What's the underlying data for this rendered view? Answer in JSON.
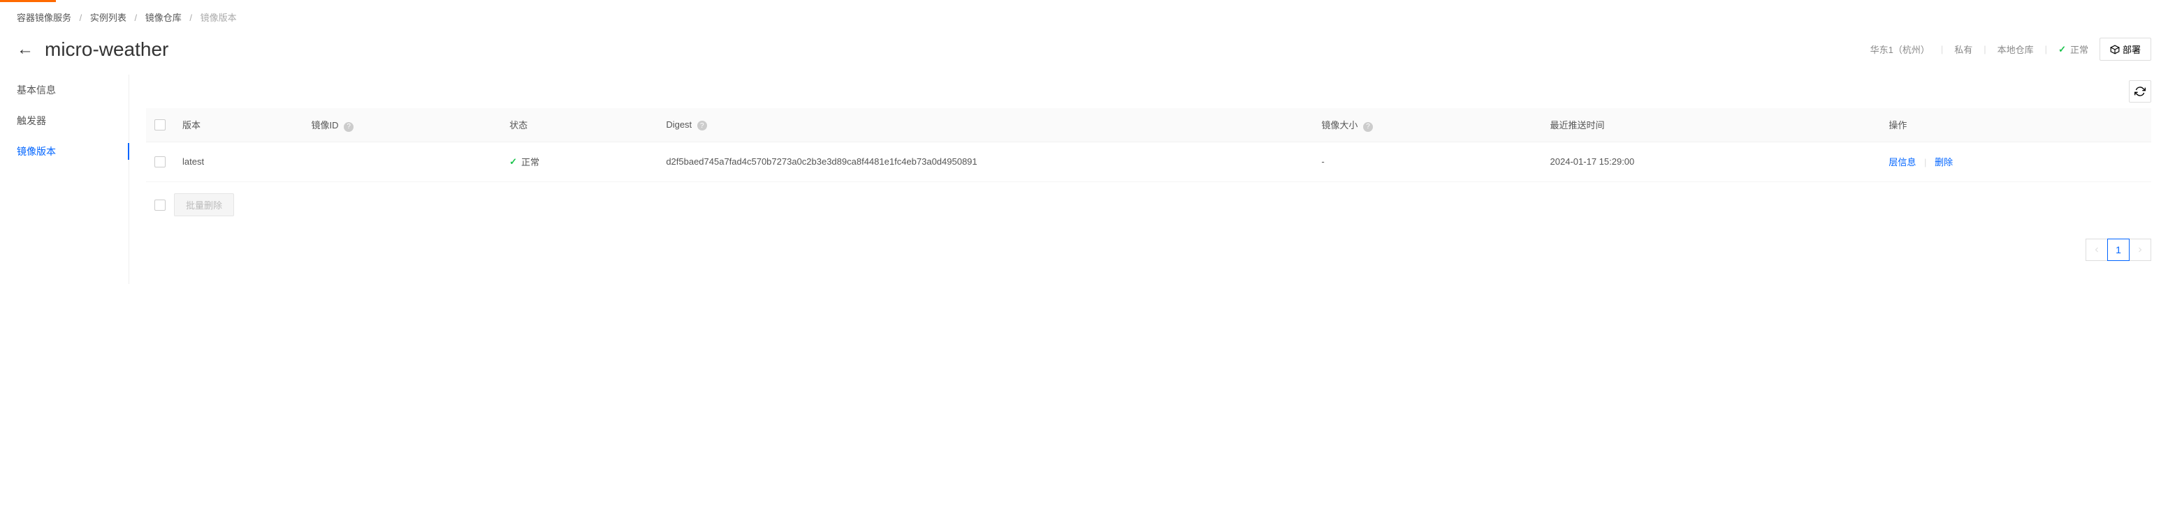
{
  "breadcrumb": {
    "items": [
      "容器镜像服务",
      "实例列表",
      "镜像仓库"
    ],
    "current": "镜像版本"
  },
  "header": {
    "title": "micro-weather",
    "region": "华东1（杭州）",
    "visibility": "私有",
    "repo_type": "本地仓库",
    "status_label": "正常",
    "deploy_label": "部署"
  },
  "sidebar": {
    "items": [
      {
        "label": "基本信息",
        "active": false
      },
      {
        "label": "触发器",
        "active": false
      },
      {
        "label": "镜像版本",
        "active": true
      }
    ]
  },
  "table": {
    "columns": {
      "version": "版本",
      "image_id": "镜像ID",
      "status": "状态",
      "digest": "Digest",
      "size": "镜像大小",
      "push_time": "最近推送时间",
      "action": "操作"
    },
    "rows": [
      {
        "version": "latest",
        "image_id": "",
        "status": "正常",
        "digest": "d2f5baed745a7fad4c570b7273a0c2b3e3d89ca8f4481e1fc4eb73a0d4950891",
        "size": "-",
        "push_time": "2024-01-17 15:29:00",
        "action_layer": "层信息",
        "action_delete": "删除"
      }
    ],
    "batch_delete_label": "批量删除"
  },
  "pagination": {
    "current": "1"
  }
}
